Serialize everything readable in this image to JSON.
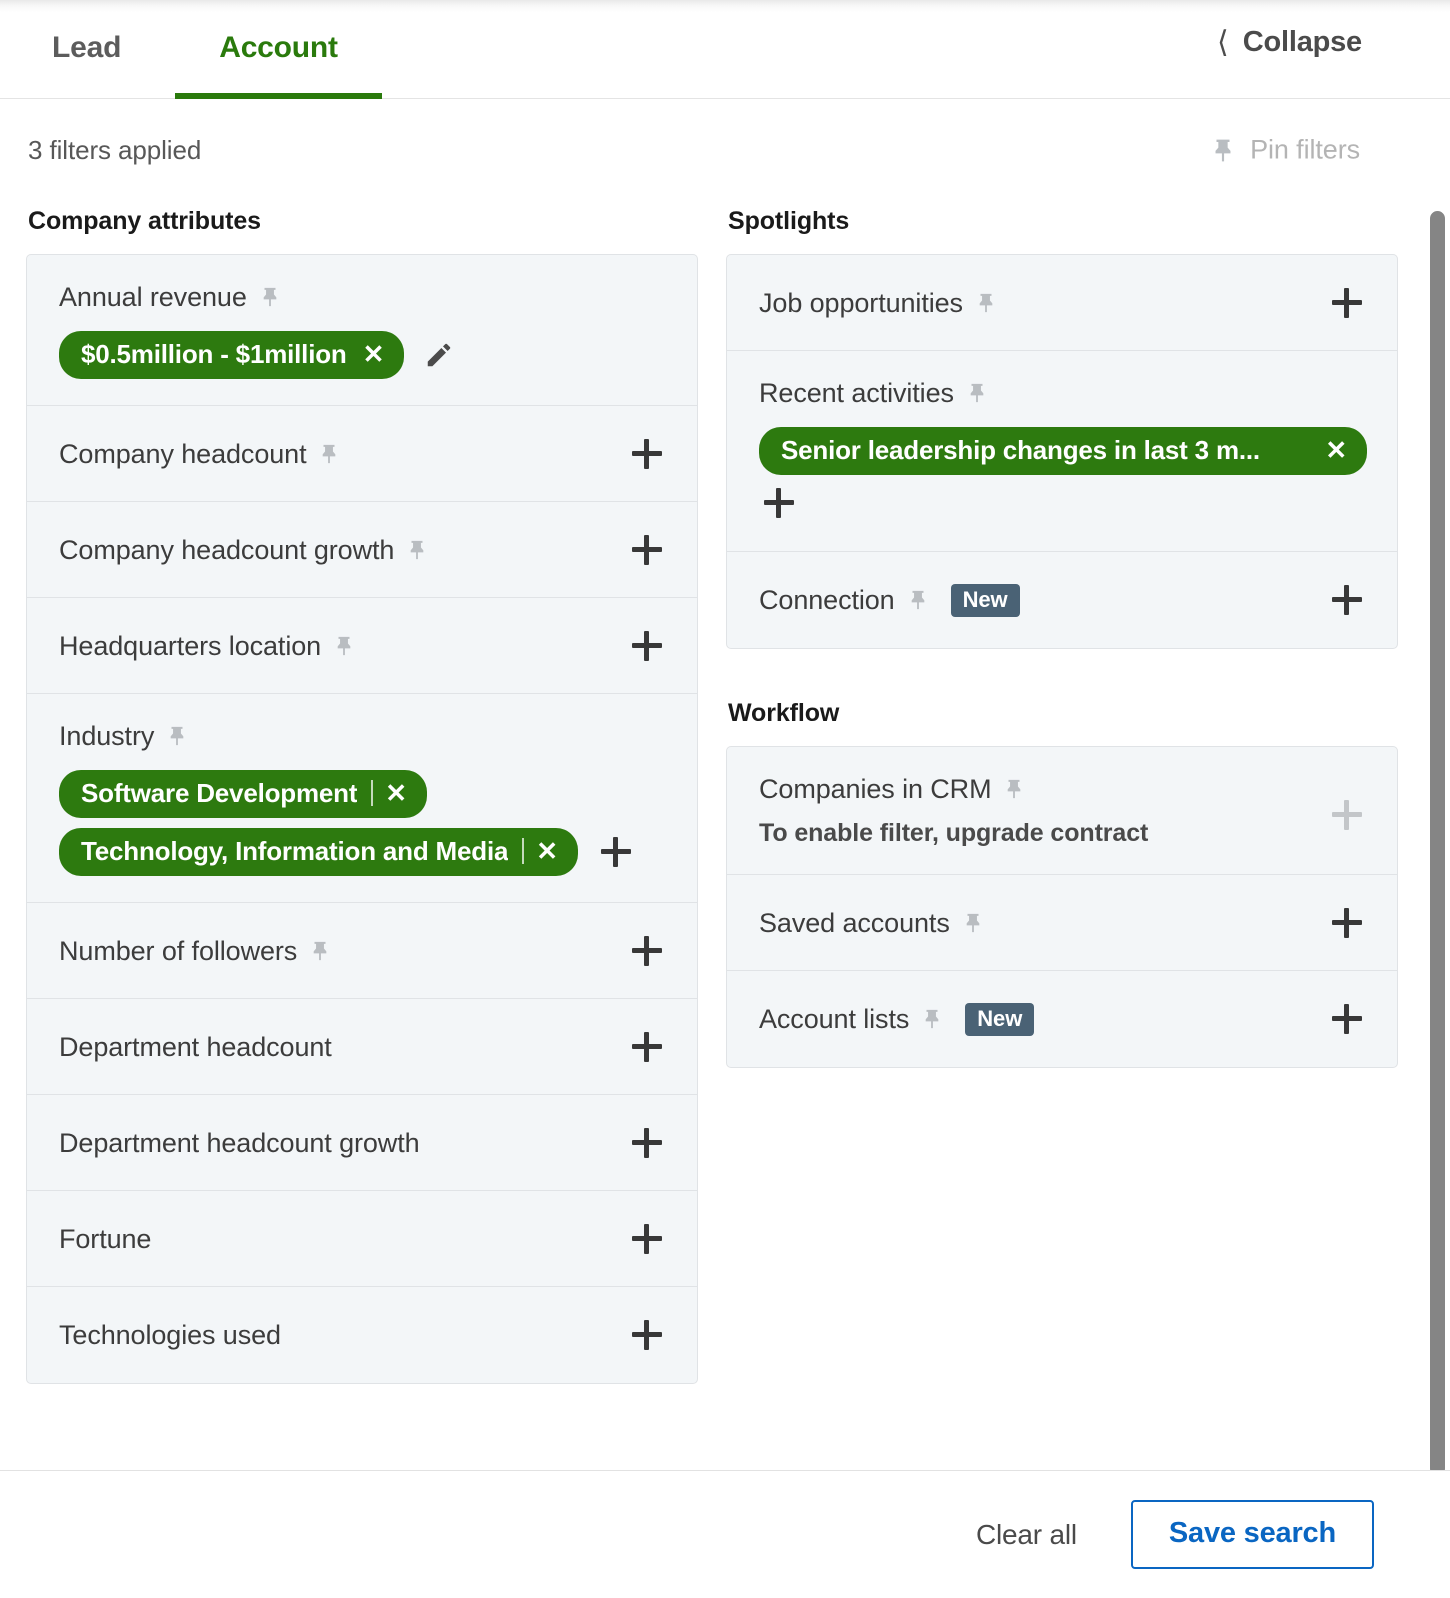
{
  "header": {
    "tabs": [
      {
        "label": "Lead",
        "active": false
      },
      {
        "label": "Account",
        "active": true
      }
    ],
    "collapse_label": "Collapse",
    "collapse_icon": "chevron-left-icon"
  },
  "meta": {
    "filters_applied": "3 filters applied",
    "pin_filters_label": "Pin filters",
    "pin_icon": "pin-icon"
  },
  "colors": {
    "accent_green": "#2d7a0f",
    "tab_active": "#2a7a0c",
    "link_blue": "#0a66c2",
    "badge_slate": "#4a6275",
    "card_bg": "#f3f6f8",
    "card_border": "#e0e3e6"
  },
  "left_column": {
    "group_title": "Company attributes",
    "rows": [
      {
        "label": "Annual revenue",
        "pin": true,
        "plus": false,
        "pills": [
          {
            "text": "$0.5million - $1million",
            "separator": false,
            "close": "✕"
          }
        ],
        "pencil": true
      },
      {
        "label": "Company headcount",
        "pin": true,
        "plus": true,
        "pills": []
      },
      {
        "label": "Company headcount growth",
        "pin": true,
        "plus": true,
        "pills": []
      },
      {
        "label": "Headquarters location",
        "pin": true,
        "plus": true,
        "pills": []
      },
      {
        "label": "Industry",
        "pin": true,
        "plus": false,
        "pills": [
          {
            "text": "Software Development",
            "separator": true,
            "close": "✕"
          },
          {
            "text": "Technology, Information and Media",
            "separator": true,
            "close": "✕"
          }
        ],
        "trailing_plus": true
      },
      {
        "label": "Number of followers",
        "pin": true,
        "plus": true,
        "pills": []
      },
      {
        "label": "Department headcount",
        "pin": false,
        "plus": true,
        "pills": []
      },
      {
        "label": "Department headcount growth",
        "pin": false,
        "plus": true,
        "pills": []
      },
      {
        "label": "Fortune",
        "pin": false,
        "plus": true,
        "pills": []
      },
      {
        "label": "Technologies used",
        "pin": false,
        "plus": true,
        "pills": []
      }
    ]
  },
  "right_column": {
    "spotlights": {
      "group_title": "Spotlights",
      "rows": [
        {
          "label": "Job opportunities",
          "pin": true,
          "plus": true,
          "pills": []
        },
        {
          "label": "Recent activities",
          "pin": true,
          "plus": false,
          "pills": [
            {
              "text": "Senior leadership changes in last 3 m...",
              "separator": false,
              "close": "✕"
            }
          ],
          "below_plus": true
        },
        {
          "label": "Connection",
          "pin": true,
          "badge": "New",
          "plus": true,
          "pills": []
        }
      ]
    },
    "workflow": {
      "group_title": "Workflow",
      "rows": [
        {
          "label": "Companies in CRM",
          "pin": true,
          "plus": true,
          "plus_disabled": true,
          "note": "To enable filter, upgrade contract",
          "pills": []
        },
        {
          "label": "Saved accounts",
          "pin": true,
          "plus": true,
          "pills": []
        },
        {
          "label": "Account lists",
          "pin": true,
          "badge": "New",
          "plus": true,
          "pills": []
        }
      ]
    }
  },
  "footer": {
    "clear_all": "Clear all",
    "save_search": "Save search"
  }
}
